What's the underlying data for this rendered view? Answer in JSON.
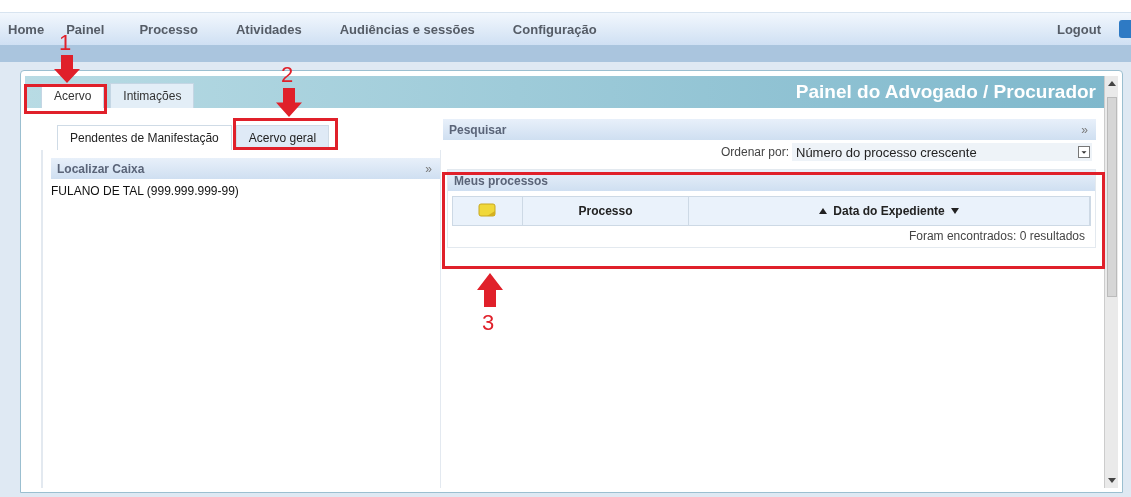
{
  "menu": [
    {
      "label": "Home"
    },
    {
      "label": "Painel"
    },
    {
      "label": "Processo"
    },
    {
      "label": "Atividades"
    },
    {
      "label": "Audiências e sessões"
    },
    {
      "label": "Configuração"
    }
  ],
  "logout": "Logout",
  "title": "Painel do Advogado / Procurador",
  "tabs": [
    {
      "label": "Acervo",
      "selected": true
    },
    {
      "label": "Intimações",
      "selected": false
    }
  ],
  "subtabs": [
    {
      "label": "Pendentes de Manifestação",
      "selected": true
    },
    {
      "label": "Acervo geral",
      "selected": false
    }
  ],
  "left_panel": {
    "header": "Localizar Caixa",
    "toggle": "»",
    "items": [
      "FULANO DE TAL (999.999.999-99)"
    ]
  },
  "search_panel": {
    "header": "Pesquisar",
    "toggle": "»"
  },
  "sort": {
    "label": "Ordenar por:",
    "value": "Número do processo crescente"
  },
  "results": {
    "header": "Meus processos",
    "columns": [
      "Processo",
      "Data do Expediente"
    ],
    "footer": "Foram encontrados: 0 resultados"
  },
  "annotations": [
    {
      "number": "1"
    },
    {
      "number": "2"
    },
    {
      "number": "3"
    }
  ]
}
